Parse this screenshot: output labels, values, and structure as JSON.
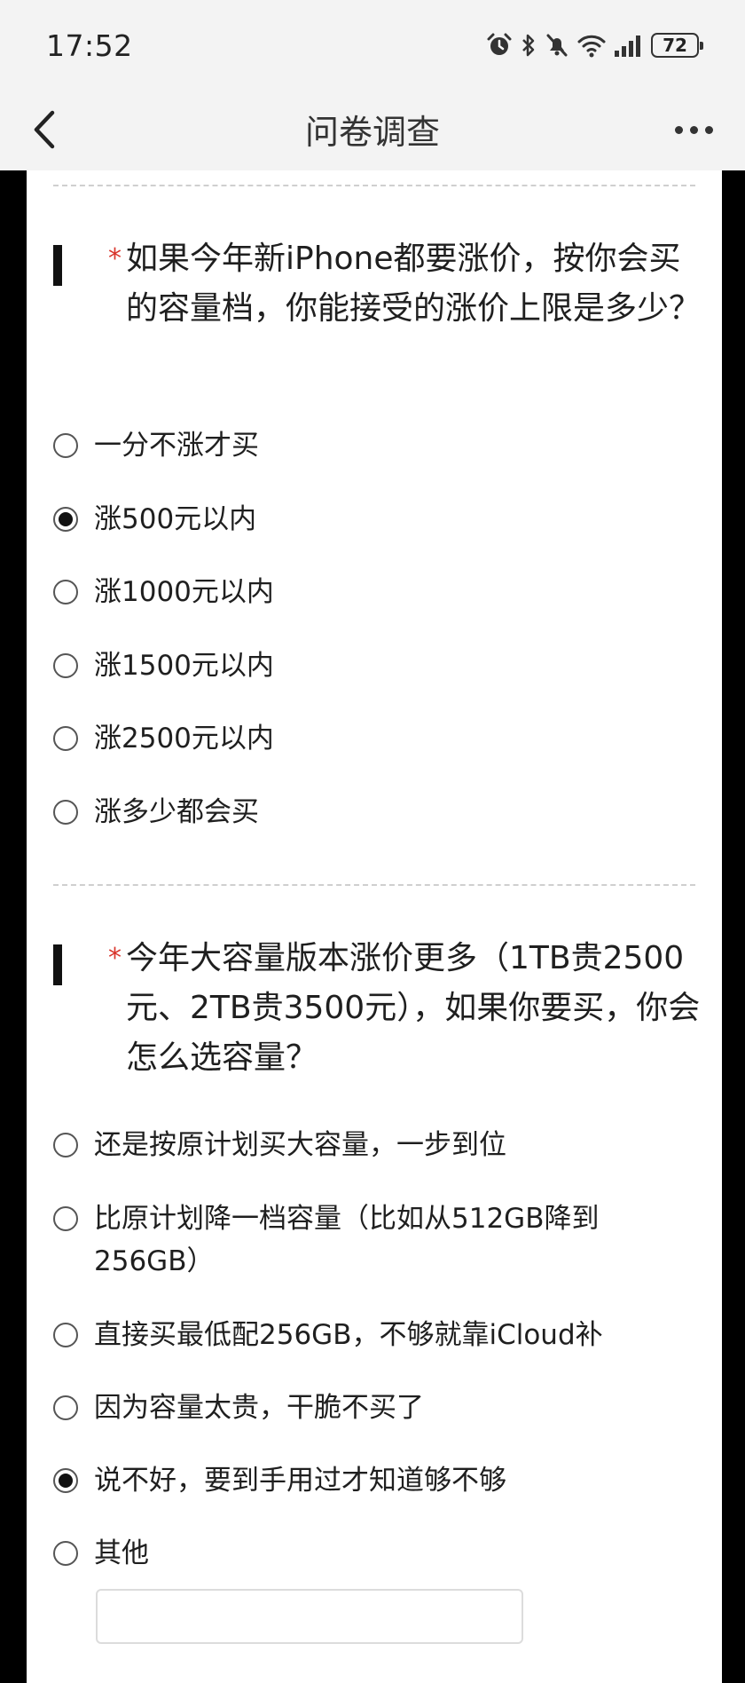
{
  "status_bar": {
    "time": "17:52",
    "battery": "72",
    "icons": [
      "alarm-icon",
      "bluetooth-icon",
      "mute-icon",
      "wifi-icon",
      "signal-icon",
      "battery-icon"
    ]
  },
  "nav": {
    "title": "问卷调查",
    "back_icon": "chevron-left-icon",
    "more_icon": "more-dots-icon"
  },
  "questions": [
    {
      "required": "*",
      "title": "如果今年新iPhone都要涨价，按你会买的容量档，你能接受的涨价上限是多少？",
      "options": [
        {
          "label": "一分不涨才买",
          "selected": false
        },
        {
          "label": "涨500元以内",
          "selected": true
        },
        {
          "label": "涨1000元以内",
          "selected": false
        },
        {
          "label": "涨1500元以内",
          "selected": false
        },
        {
          "label": "涨2500元以内",
          "selected": false
        },
        {
          "label": "涨多少都会买",
          "selected": false
        }
      ]
    },
    {
      "required": "*",
      "title": "今年大容量版本涨价更多（1TB贵2500元、2TB贵3500元），如果你要买，你会怎么选容量？",
      "options": [
        {
          "label": "还是按原计划买大容量，一步到位",
          "selected": false
        },
        {
          "label": "比原计划降一档容量（比如从512GB降到256GB）",
          "selected": false
        },
        {
          "label": "直接买最低配256GB，不够就靠iCloud补",
          "selected": false
        },
        {
          "label": "因为容量太贵，干脆不买了",
          "selected": false
        },
        {
          "label": "说不好，要到手用过才知道够不够",
          "selected": true
        },
        {
          "label": "其他",
          "selected": false
        }
      ],
      "other_input_value": ""
    }
  ]
}
